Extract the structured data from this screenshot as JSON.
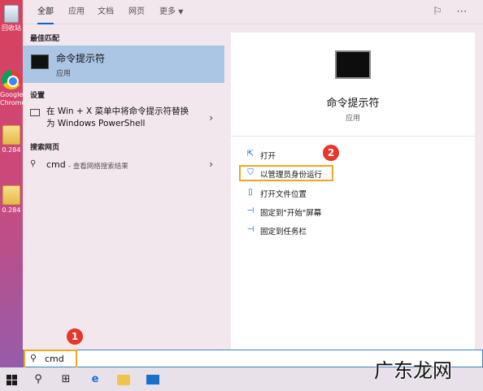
{
  "desktop": {
    "items": [
      {
        "label": "回收站"
      },
      {
        "label": "Google Chrome"
      },
      {
        "label": "0.284"
      },
      {
        "label": "0.284"
      }
    ]
  },
  "tabs": [
    "全部",
    "应用",
    "文档",
    "网页",
    "更多"
  ],
  "best_match": {
    "heading": "最佳匹配",
    "title": "命令提示符",
    "subtitle": "应用"
  },
  "settings": {
    "heading": "设置",
    "item": "在 Win + X 菜单中将命令提示符替换为 Windows PowerShell"
  },
  "web": {
    "heading": "搜索网页",
    "query": "cmd",
    "suffix": "- 查看网络搜索结果"
  },
  "detail": {
    "title": "命令提示符",
    "subtitle": "应用",
    "actions": [
      {
        "label": "打开",
        "icon": "open-icon"
      },
      {
        "label": "以管理员身份运行",
        "icon": "shield-icon"
      },
      {
        "label": "打开文件位置",
        "icon": "file-location-icon"
      },
      {
        "label": "固定到\"开始\"屏幕",
        "icon": "pin-icon"
      },
      {
        "label": "固定到任务栏",
        "icon": "pin-icon"
      }
    ]
  },
  "search": {
    "value": "cmd"
  },
  "badges": [
    "1",
    "2"
  ],
  "watermark": "广东龙网",
  "colors": {
    "accent": "#0a64c8",
    "highlight": "#f2a51e",
    "badge": "#e8352a"
  }
}
